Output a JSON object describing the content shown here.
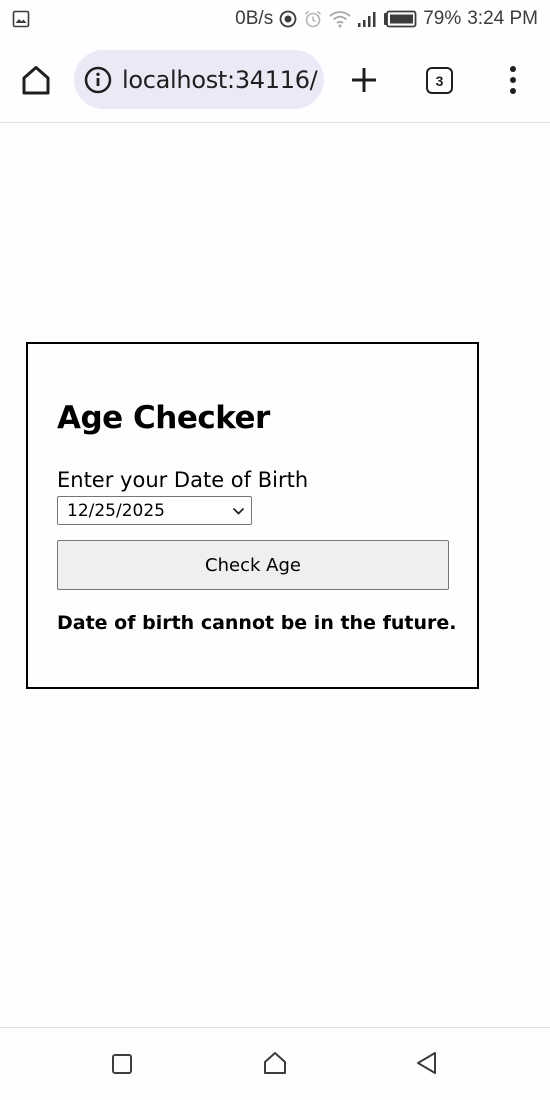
{
  "status_bar": {
    "net_speed": "0B/s",
    "battery": "79%",
    "time": "3:24 PM"
  },
  "browser": {
    "url": "localhost:34116/",
    "tab_count": "3"
  },
  "page": {
    "title": "Age Checker",
    "dob_label": "Enter your Date of Birth",
    "dob_value": "12/25/2025",
    "check_button": "Check Age",
    "result": "Date of birth cannot be in the future."
  }
}
